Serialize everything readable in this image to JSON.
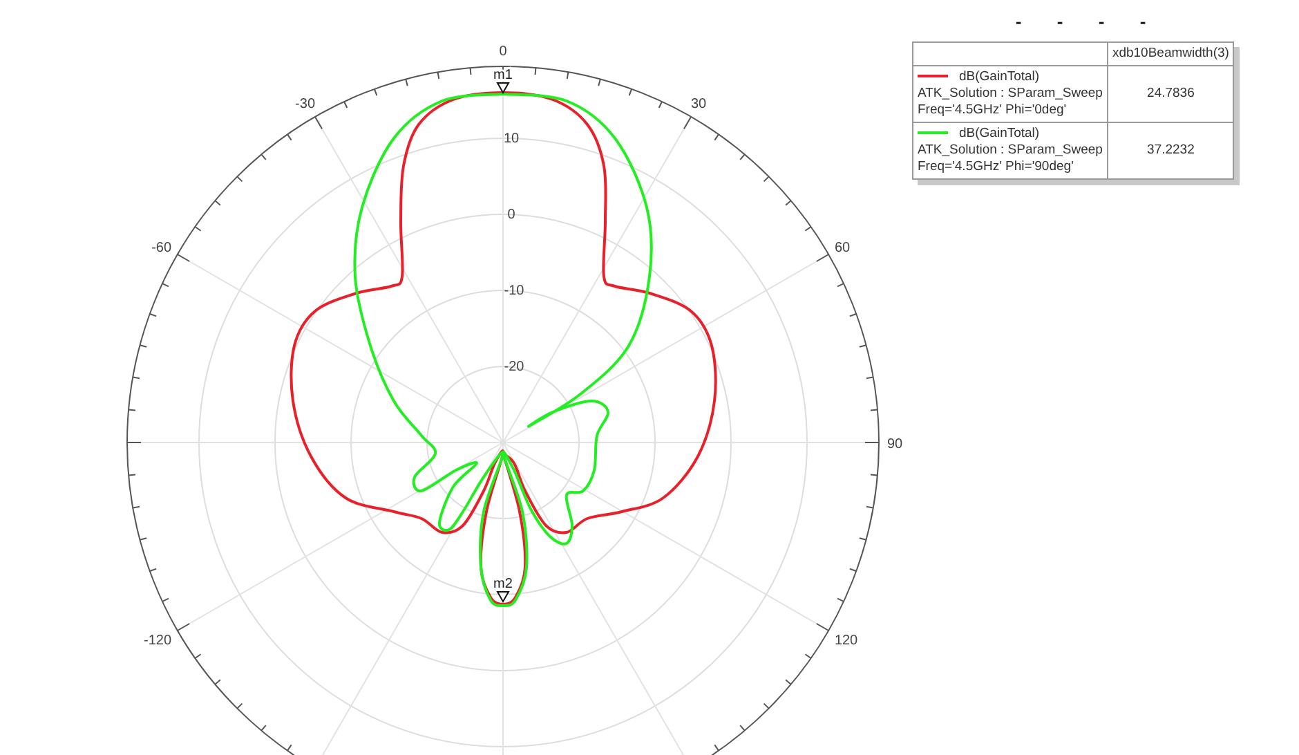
{
  "top_marks": [
    "-",
    "-",
    "-",
    "-"
  ],
  "plot": {
    "angle_labels": [
      "-120",
      "-60",
      "-30",
      "0",
      "30",
      "60",
      "90",
      "120"
    ],
    "radius_labels": [
      "10",
      "0",
      "-10",
      "-20"
    ],
    "markers": [
      {
        "label": "m1"
      },
      {
        "label": "m2"
      }
    ]
  },
  "legend": {
    "header": "xdb10Beamwidth(3)",
    "rows": [
      {
        "color": "#e8202a",
        "lines": [
          "dB(GainTotal)",
          "ATK_Solution : SParam_Sweep",
          "Freq='4.5GHz' Phi='0deg'"
        ],
        "value": "24.7836"
      },
      {
        "color": "#22ee22",
        "lines": [
          "dB(GainTotal)",
          "ATK_Solution : SParam_Sweep",
          "Freq='4.5GHz' Phi='90deg'"
        ],
        "value": "37.2232"
      }
    ]
  }
}
